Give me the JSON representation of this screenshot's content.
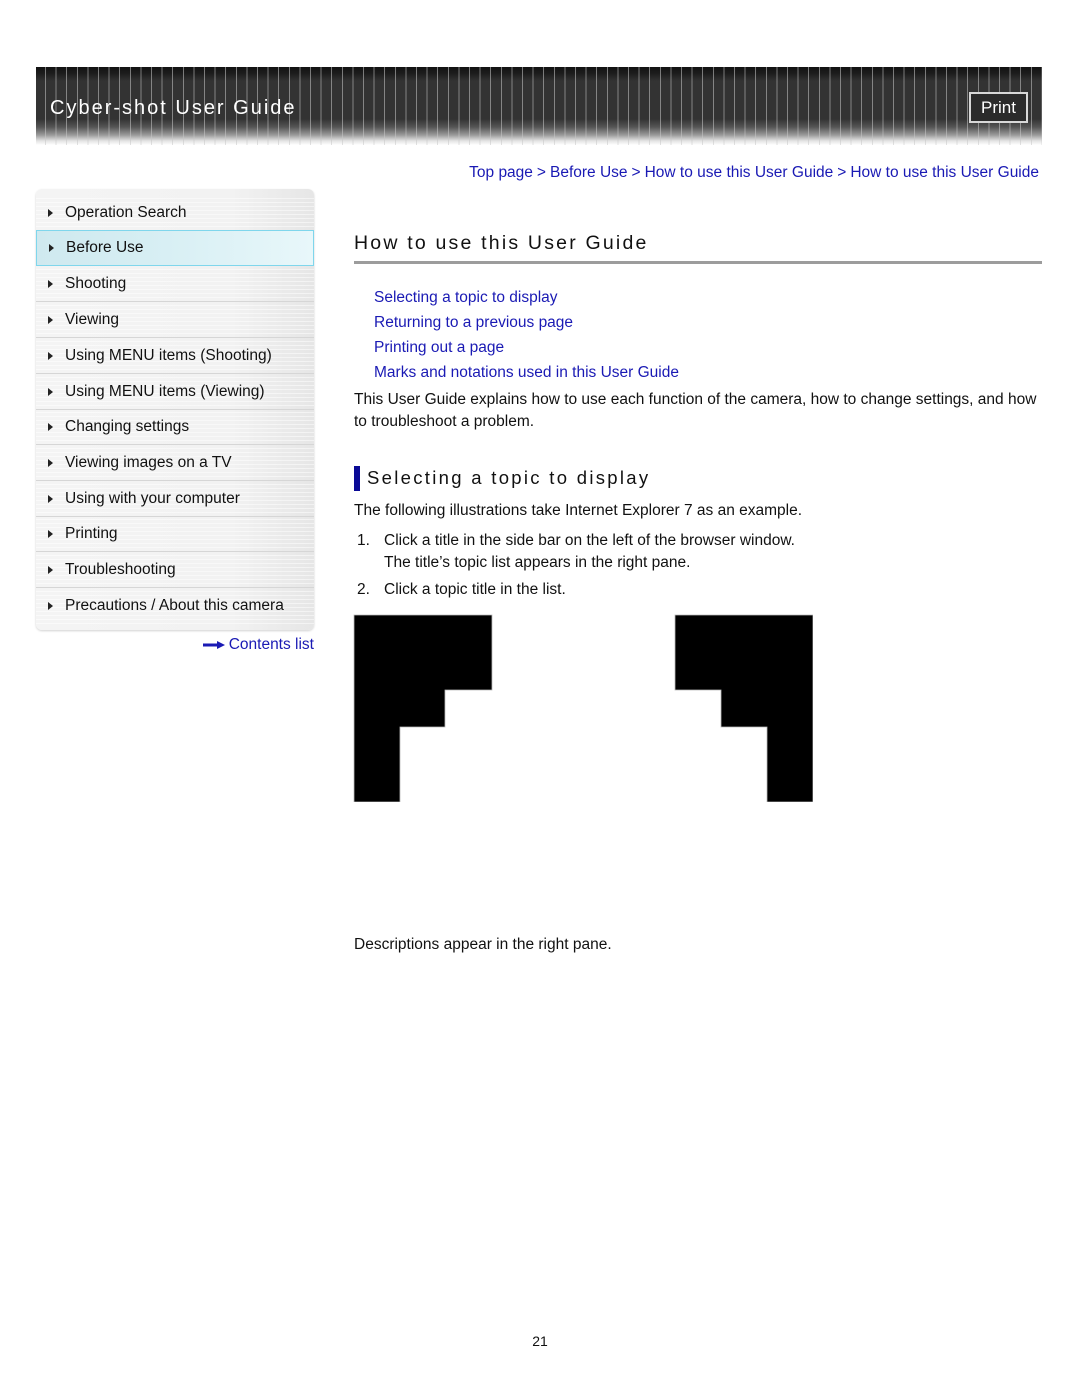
{
  "header": {
    "title": "Cyber-shot User Guide",
    "print_label": "Print"
  },
  "breadcrumb": [
    {
      "label": "Top page"
    },
    {
      "label": "Before Use"
    },
    {
      "label": "How to use this User Guide"
    },
    {
      "label": "How to use this User Guide"
    }
  ],
  "breadcrumb_separator": ">",
  "sidebar": {
    "items": [
      {
        "label": "Operation Search",
        "active": false
      },
      {
        "label": "Before Use",
        "active": true
      },
      {
        "label": "Shooting",
        "active": false
      },
      {
        "label": "Viewing",
        "active": false
      },
      {
        "label": "Using MENU items (Shooting)",
        "active": false
      },
      {
        "label": "Using MENU items (Viewing)",
        "active": false
      },
      {
        "label": "Changing settings",
        "active": false
      },
      {
        "label": "Viewing images on a TV",
        "active": false
      },
      {
        "label": "Using with your computer",
        "active": false
      },
      {
        "label": "Printing",
        "active": false
      },
      {
        "label": "Troubleshooting",
        "active": false
      },
      {
        "label": "Precautions / About this camera",
        "active": false
      }
    ],
    "contents_link": "Contents list"
  },
  "main": {
    "title": "How to use this User Guide",
    "toc": [
      {
        "label": "Selecting a topic to display"
      },
      {
        "label": "Returning to a previous page"
      },
      {
        "label": "Printing out a page"
      },
      {
        "label": "Marks and notations used in this User Guide"
      }
    ],
    "intro": "This User Guide explains how to use each function of the camera, how to change settings, and how to troubleshoot a problem.",
    "section": {
      "title": "Selecting a topic to display",
      "intro": "The following illustrations take Internet Explorer 7 as an example.",
      "steps": [
        {
          "num": "1.",
          "text": "Click a title in the side bar on the left of the browser window.",
          "sub": "The title’s topic list appears in the right pane."
        },
        {
          "num": "2.",
          "text": "Click a topic title in the list.",
          "sub": ""
        }
      ],
      "description": "Descriptions appear in the right pane."
    }
  },
  "footer": {
    "page_number": "21"
  },
  "colors": {
    "link": "#1a1ab4",
    "section_bar": "#0a0a96",
    "active_item_border": "#7fd6ec",
    "banner": "#333333"
  }
}
